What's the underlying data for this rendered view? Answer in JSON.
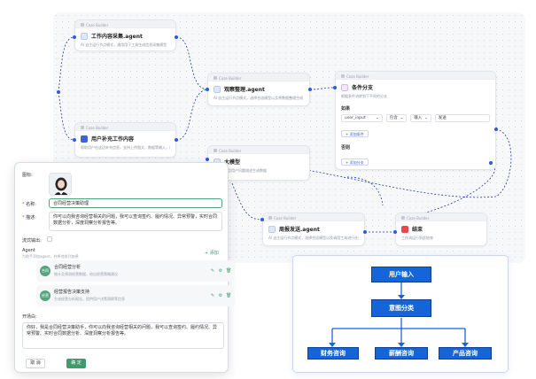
{
  "canvas": {
    "node_header": "Coze Builder",
    "nodes": {
      "work": {
        "title": "工作内容采集.agent",
        "desc": "AI 自主运行节点模式，通用用于工具生成信息采集模型"
      },
      "user": {
        "title": "用户补充工作内容",
        "desc": "帮助用户在这边补充信息，支持上传图文、数据等输入，请客输入"
      },
      "organize": {
        "title": "观察整理.agent",
        "desc": "AI 自主运行节点模式，选择合适模型以及将数据整理生成"
      },
      "cond": {
        "title": "条件分支",
        "desc": "根据条件流转到下不同的分支",
        "if_label": "如果",
        "var": "user_input",
        "op": "包含",
        "input_type": "输入",
        "value": "发送",
        "add_cond": "+ 添加条件",
        "else_label": "否则",
        "add_branch": "+ 添加分支"
      },
      "model": {
        "title": "大模型",
        "desc": "调用大模型用户问题描述生成数据"
      },
      "weekly": {
        "title": "周报发送.agent",
        "desc": "AI 自主运行节点模式，选择合适模型以及调用工具进行任务"
      },
      "end": {
        "title": "结束",
        "desc": "工作流运行到此结束"
      }
    }
  },
  "panel": {
    "icon_label": "图标:",
    "name_label": "名称:",
    "name_value": "合同经营决策助理",
    "desc_label": "描述:",
    "desc_value": "你可以向我咨询经营相关的问题，我可以查询签约、履约情况、异常预警，实时合同数据分析，深度洞察分析报告等。",
    "stream_label": "流式输出:",
    "agent_label": "Agent",
    "agent_hint": "为助手添加agent，并将他排列加德",
    "add_label": "添加",
    "agents": [
      {
        "badge": "合同",
        "name": "合同经营分析",
        "desc": "统计及预测经营数据，给出经营策略建议"
      },
      {
        "badge": "经营",
        "name": "经营报告决策支持",
        "desc": "生成经营分析报告，提供用户决策洞察等信息"
      }
    ],
    "opening_label": "开场白:",
    "opening_value": "你好，我是合同经营决策助手，你可以向我咨询经营相关的问题，我可以查询签约、履约情况、异常预警、实时合同数据分析、深度洞察分析报告等。",
    "cancel_label": "取 消",
    "ok_label": "确 定"
  },
  "flow": {
    "input": "用户输入",
    "classify": "意图分类",
    "branches": [
      "财务咨询",
      "薪酬咨询",
      "产品咨询"
    ]
  },
  "colors": {
    "accent": "#2f5bd8",
    "flow_box": "#1565d8",
    "confirm": "#3f9a6c"
  }
}
